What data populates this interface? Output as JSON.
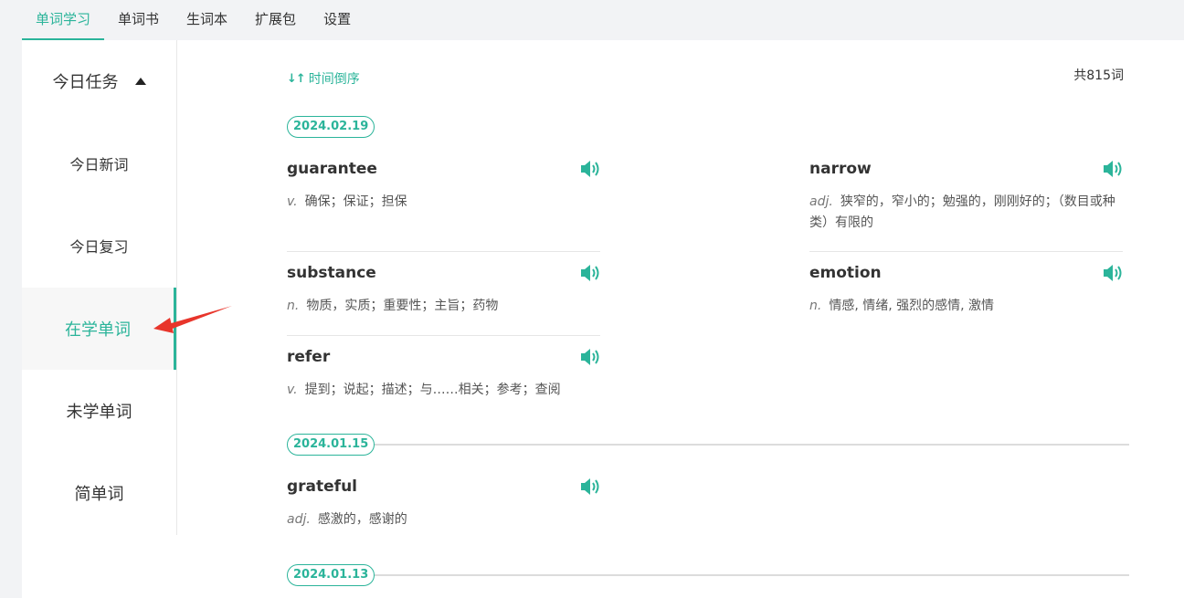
{
  "nav": {
    "tabs": [
      "单词学习",
      "单词书",
      "生词本",
      "扩展包",
      "设置"
    ]
  },
  "sidebar": {
    "today_task": "今日任务",
    "today_new": "今日新词",
    "today_review": "今日复习",
    "learning": "在学单词",
    "unlearned": "未学单词",
    "simple": "简单词"
  },
  "list": {
    "sort_label": "时间倒序",
    "total": "共815词",
    "groups": [
      {
        "date": "2024.02.19",
        "words": [
          {
            "word": "guarantee",
            "pos": "v.",
            "meaning": "确保；保证；担保"
          },
          {
            "word": "narrow",
            "pos": "adj.",
            "meaning": "狭窄的，窄小的；勉强的，刚刚好的；（数目或种类）有限的"
          },
          {
            "word": "substance",
            "pos": "n.",
            "meaning": "物质，实质；重要性；主旨；药物"
          },
          {
            "word": "emotion",
            "pos": "n.",
            "meaning": "情感, 情绪, 强烈的感情, 激情"
          },
          {
            "word": "refer",
            "pos": "v.",
            "meaning": "提到；说起；描述；与……相关；参考；查阅"
          }
        ]
      },
      {
        "date": "2024.01.15",
        "words": [
          {
            "word": "grateful",
            "pos": "adj.",
            "meaning": "感激的，感谢的"
          }
        ]
      },
      {
        "date": "2024.01.13",
        "words": []
      }
    ]
  },
  "colors": {
    "accent": "#2bb49a",
    "arrow": "#e8352b"
  },
  "icons": {
    "speaker": "speaker-icon",
    "sort": "sort-icon",
    "caret": "caret-up-icon"
  }
}
